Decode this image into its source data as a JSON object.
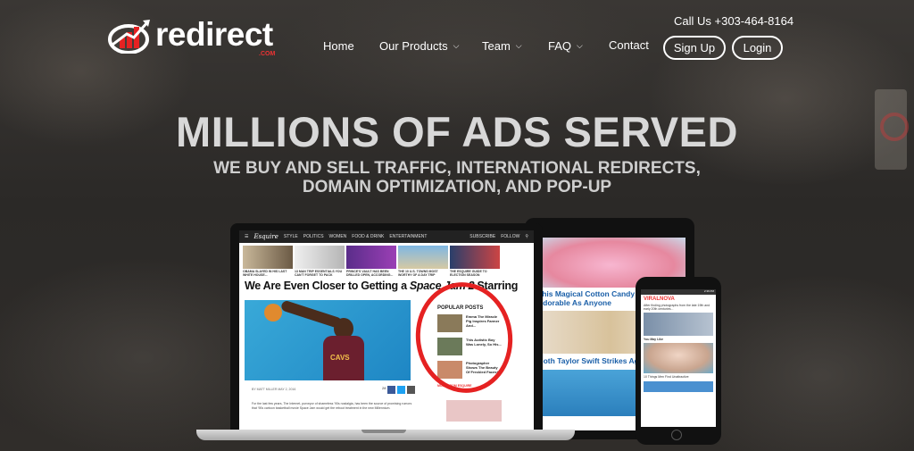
{
  "header": {
    "logo_text": "redirect",
    "logo_sub": ".COM",
    "phone": "Call Us +303-464-8164",
    "nav": [
      {
        "label": "Home",
        "has_dropdown": false
      },
      {
        "label": "Our Products",
        "has_dropdown": true
      },
      {
        "label": "Team",
        "has_dropdown": true
      },
      {
        "label": "FAQ",
        "has_dropdown": true
      },
      {
        "label": "Contact",
        "has_dropdown": false
      }
    ],
    "signup_label": "Sign Up",
    "login_label": "Login"
  },
  "hero": {
    "title": "MILLIONS OF ADS SERVED",
    "subtitle_line1": "WE BUY AND SELL TRAFFIC, INTERNATIONAL REDIRECTS,",
    "subtitle_line2": "DOMAIN OPTIMIZATION, AND POP-UP"
  },
  "laptop_site": {
    "brand": "Esquire",
    "nav_items": [
      "STYLE",
      "POLITICS",
      "WOMEN",
      "FOOD & DRINK",
      "ENTERTAINMENT"
    ],
    "nav_right": [
      "SUBSCRIBE",
      "FOLLOW"
    ],
    "captions": [
      "OBAMA SLAYED IN HIS LAST WHITE HOUSE...",
      "13 MAN TRIP ESSENTIALS YOU CAN'T FORGET TO PACK",
      "PRINCE'S VAULT HAS BEEN DRILLED OPEN, ACCORDING...",
      "THE 10 U.S. TOWNS MOST WORTHY OF A DAY TRIP",
      "THE ESQUIRE GUIDE TO ELECTION SEASON"
    ],
    "headline_prefix": "We Are Even Closer to Getting a ",
    "headline_em": "Space Jam 2",
    "headline_suffix": " Starring",
    "jersey": "CAVS",
    "popular_title": "POPULAR POSTS",
    "popular": [
      "Emma The Miracle Pig Inspires Farmer And...",
      "This Autistic Boy Was Lonely, So His...",
      "Photographer Shows The Beauty Of Freckled Faces!"
    ],
    "more_label": "MORE FROM ESQUIRE",
    "byline": "BY MATT MILLER   MAY 2, 2016",
    "share_count": "28",
    "body": "For the last few years, The Internet, purveyor of shameless '90s nostalgia, has been the source of promising rumors that '90s cartoon basketball movie Space Jam would get the reboot treatment in the new Millennium."
  },
  "tablet_site": {
    "headline1": "This Magical Cotton Candy On Is Just Adorable As Anyone",
    "headline2": "Goth Taylor Swift Strikes Again"
  },
  "phone_site": {
    "status": "2:36 PM",
    "logo": "VIRALNOVA",
    "text1": "After finding photographs from the late 19th and early 20th centuries...",
    "label": "You May Like",
    "text2": "10 Things Men Find Unattractive"
  },
  "colors": {
    "accent_red": "#e52222",
    "headline_blue": "#1a5fa8"
  }
}
